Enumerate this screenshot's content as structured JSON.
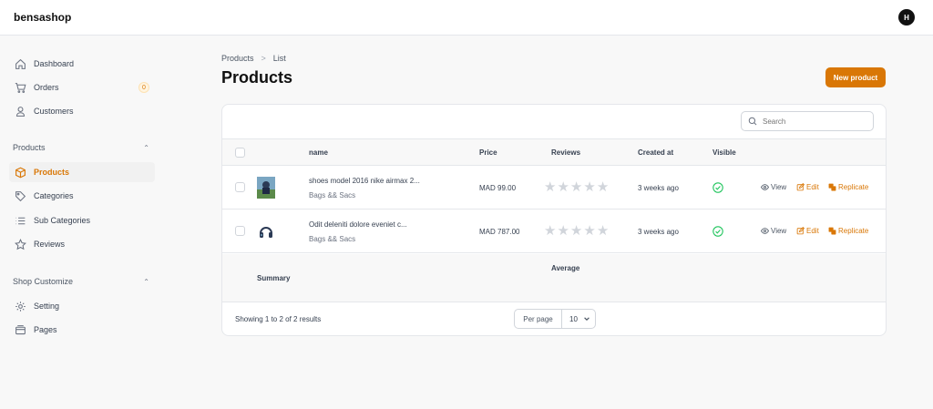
{
  "app": {
    "brand": "bensashop",
    "avatar_initial": "H"
  },
  "sidebar": {
    "items": [
      {
        "label": "Dashboard",
        "icon": "home-icon"
      },
      {
        "label": "Orders",
        "icon": "cart-icon",
        "badge": "0"
      },
      {
        "label": "Customers",
        "icon": "user-icon"
      }
    ],
    "groups": [
      {
        "label": "Products",
        "items": [
          {
            "label": "Products",
            "icon": "cube-icon",
            "active": true
          },
          {
            "label": "Categories",
            "icon": "tag-icon"
          },
          {
            "label": "Sub Categories",
            "icon": "list-icon"
          },
          {
            "label": "Reviews",
            "icon": "star-icon"
          }
        ]
      },
      {
        "label": "Shop Customize",
        "items": [
          {
            "label": "Setting",
            "icon": "gear-icon"
          },
          {
            "label": "Pages",
            "icon": "pages-icon"
          }
        ]
      }
    ]
  },
  "breadcrumb": {
    "items": [
      "Products",
      "List"
    ],
    "separator": ">"
  },
  "page": {
    "title": "Products",
    "new_button": "New product"
  },
  "table": {
    "search_placeholder": "Search",
    "columns": {
      "name": "name",
      "price": "Price",
      "reviews": "Reviews",
      "created": "Created at",
      "visible": "Visible"
    },
    "rows": [
      {
        "name": "shoes model 2016 nike airmax 2...",
        "category": "Bags && Sacs",
        "price": "MAD 99.00",
        "rating": 0,
        "created": "3 weeks ago",
        "visible": true
      },
      {
        "name": "Odit deleniti dolore eveniet c...",
        "category": "Bags && Sacs",
        "price": "MAD 787.00",
        "rating": 0,
        "created": "3 weeks ago",
        "visible": true
      }
    ],
    "actions": {
      "view": "View",
      "edit": "Edit",
      "replicate": "Replicate"
    },
    "summary": {
      "label": "Summary",
      "average": "Average"
    },
    "footer": {
      "showing": "Showing 1 to 2 of 2 results",
      "per_page_label": "Per page",
      "per_page_value": "10"
    }
  },
  "colors": {
    "accent": "#d97706",
    "success": "#22c55e",
    "background": "#f8f8f8"
  }
}
